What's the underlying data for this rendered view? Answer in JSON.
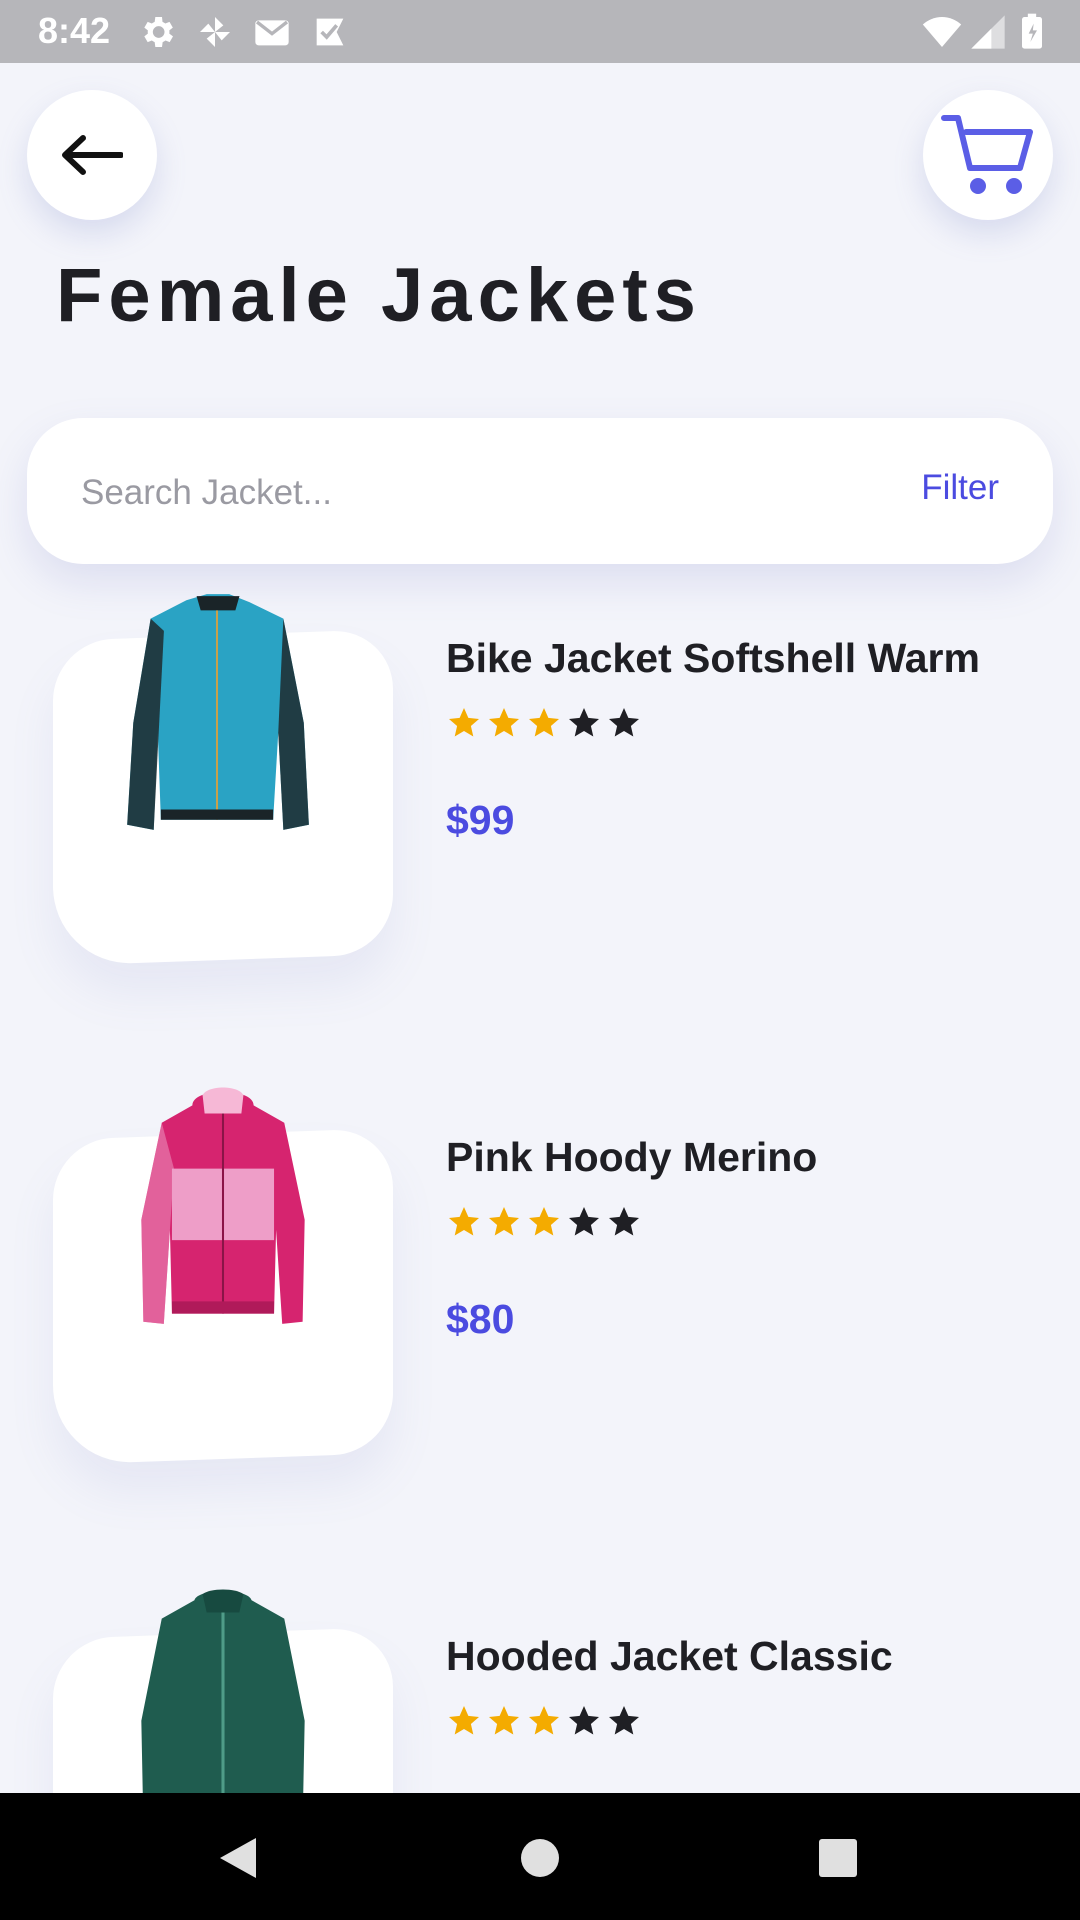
{
  "status_bar": {
    "time": "8:42",
    "icons": [
      "settings-icon",
      "pinwheel-icon",
      "gmail-icon",
      "check-icon",
      "wifi-icon",
      "signal-icon",
      "battery-icon"
    ]
  },
  "header": {
    "back_icon": "arrow-left-icon",
    "cart_icon": "cart-icon",
    "title": "Female Jackets"
  },
  "search": {
    "placeholder": "Search Jacket...",
    "filter_label": "Filter"
  },
  "products": [
    {
      "name": "Bike Jacket Softshell Warm",
      "rating": 3,
      "max_rating": 5,
      "price": "$99",
      "color": "#2aa3c4",
      "image": "blue-jacket-image"
    },
    {
      "name": "Pink Hoody Merino",
      "rating": 3,
      "max_rating": 5,
      "price": "$80",
      "color": "#d6246f",
      "image": "pink-hoody-image"
    },
    {
      "name": "Hooded Jacket Classic",
      "rating": 3,
      "max_rating": 5,
      "price": "",
      "color": "#1f5c4f",
      "image": "green-jacket-image"
    }
  ],
  "colors": {
    "accent": "#4b4be0",
    "star_filled": "#f4ab00",
    "star_empty": "#1f1f24",
    "background": "#f3f4fa"
  },
  "nav": {
    "icons": [
      "back-nav-icon",
      "home-nav-icon",
      "recents-nav-icon"
    ]
  }
}
